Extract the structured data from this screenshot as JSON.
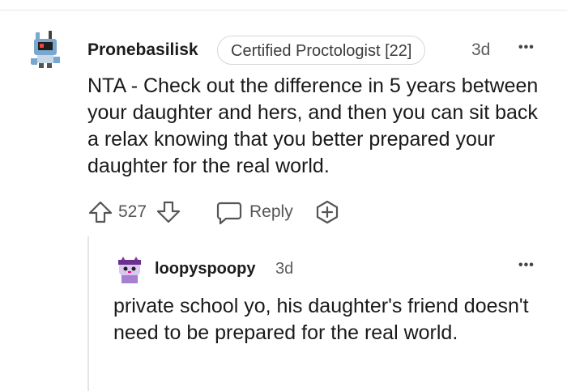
{
  "comments": [
    {
      "username": "Pronebasilisk",
      "flair": "Certified Proctologist [22]",
      "age": "3d",
      "text": "NTA - Check out the difference in 5 years between your daughter and hers, and then you can sit back a relax knowing that you better prepared your daughter for the real world.",
      "votes": "527",
      "reply_label": "Reply",
      "more": "•••"
    },
    {
      "username": "loopyspoopy",
      "age": "3d",
      "text": "private school yo, his daughter's friend doesn't need to be prepared for the real world.",
      "more": "•••"
    }
  ],
  "icons": {
    "upvote": "upvote-icon",
    "downvote": "downvote-icon",
    "reply": "reply-bubble-icon",
    "award": "award-plus-icon",
    "more": "more-options-icon"
  }
}
